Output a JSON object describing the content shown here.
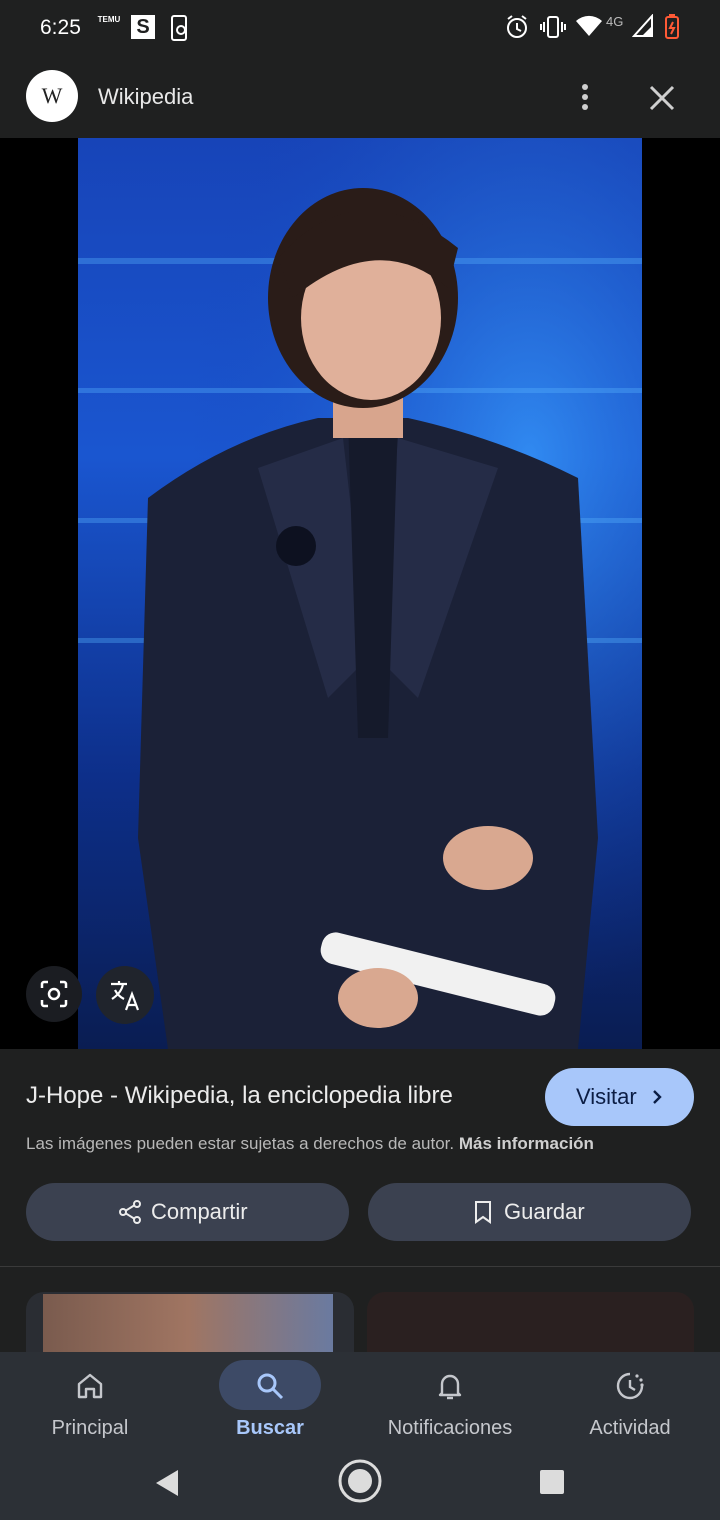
{
  "status": {
    "time": "6:25",
    "temu_label": "TEMU",
    "s_label": "S",
    "network": "4G"
  },
  "header": {
    "logo_letter": "W",
    "title": "Wikipedia"
  },
  "result": {
    "title": "J-Hope - Wikipedia, la enciclopedia libre",
    "visit_label": "Visitar",
    "copyright_text": "Las imágenes pueden estar sujetas a derechos de autor.",
    "more_info": "Más información",
    "share_label": "Compartir",
    "save_label": "Guardar"
  },
  "nav": {
    "items": [
      {
        "label": "Principal",
        "icon": "home-icon"
      },
      {
        "label": "Buscar",
        "icon": "search-icon",
        "active": true
      },
      {
        "label": "Notificaciones",
        "icon": "bell-icon"
      },
      {
        "label": "Actividad",
        "icon": "activity-icon"
      }
    ]
  },
  "colors": {
    "accent": "#a8c7fa",
    "background": "#1f2020",
    "nav_background": "#2c3036",
    "button_background": "#3b4150"
  }
}
